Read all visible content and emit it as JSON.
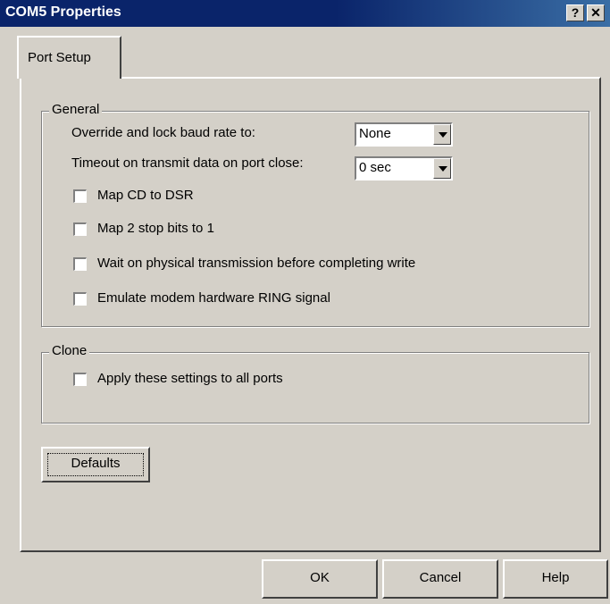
{
  "window": {
    "title": "COM5 Properties",
    "help_glyph": "?",
    "close_glyph": "✕"
  },
  "tabs": [
    {
      "label": "Port Setup",
      "selected": true
    }
  ],
  "general": {
    "group_label": "General",
    "baud_label": "Override and lock baud rate to:",
    "baud_value": "None",
    "timeout_label": "Timeout on transmit data on port close:",
    "timeout_value": "0 sec",
    "checkboxes": [
      {
        "label": "Map CD to DSR",
        "checked": false
      },
      {
        "label": "Map 2 stop bits to 1",
        "checked": false
      },
      {
        "label": "Wait on physical transmission before completing write",
        "checked": false
      },
      {
        "label": "Emulate modem hardware RING signal",
        "checked": false
      }
    ]
  },
  "clone": {
    "group_label": "Clone",
    "checkbox": {
      "label": "Apply these settings to all ports",
      "checked": false
    }
  },
  "buttons": {
    "defaults": "Defaults",
    "ok": "OK",
    "cancel": "Cancel",
    "help": "Help"
  }
}
